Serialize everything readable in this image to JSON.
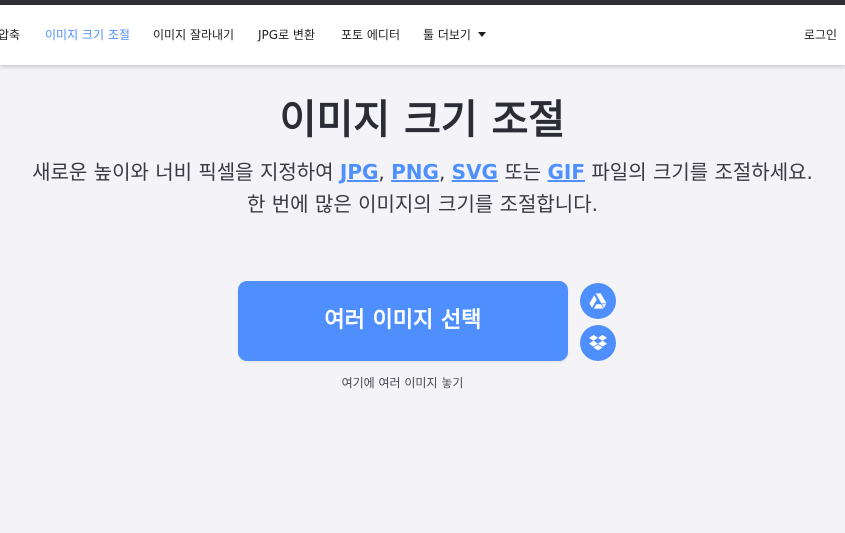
{
  "nav": {
    "items": [
      {
        "label": "압축"
      },
      {
        "label": "이미지 크기 조절",
        "active": true
      },
      {
        "label": "이미지 잘라내기"
      },
      {
        "label": "JPG로 변환"
      },
      {
        "label": "포토 에디터"
      },
      {
        "label": "툴 더보기"
      }
    ],
    "login": "로그인"
  },
  "hero": {
    "title": "이미지 크기 조절",
    "desc_prefix": "새로운 높이와 너비 픽셀을 지정하여 ",
    "format_jpg": "JPG",
    "sep1": ", ",
    "format_png": "PNG",
    "sep2": ", ",
    "format_svg": "SVG",
    "sep3": " 또는 ",
    "format_gif": "GIF",
    "desc_suffix": " 파일의 크기를 조절하세요.",
    "desc_line2": "한 번에 많은 이미지의 크기를 조절합니다."
  },
  "upload": {
    "button_label": "여러 이미지 선택",
    "drop_hint": "여기에 여러 이미지 놓기",
    "cloud_icons": [
      "google-drive-icon",
      "dropbox-icon"
    ]
  },
  "colors": {
    "accent": "#4f8ffd",
    "nav_active": "#4d90fe",
    "background": "#f4f3f8"
  }
}
